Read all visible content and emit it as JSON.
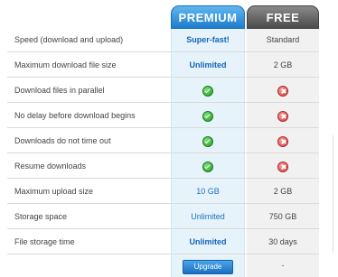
{
  "headers": {
    "premium": "PREMIUM",
    "free": "FREE"
  },
  "rows": [
    {
      "label": "Speed (download and upload)",
      "premium": "Super-fast!",
      "free": "Standard"
    },
    {
      "label": "Maximum download file size",
      "premium": "Unlimited",
      "free": "2 GB"
    },
    {
      "label": "Download files in parallel",
      "premium_icon": "check-icon",
      "free_icon": "cross-icon"
    },
    {
      "label": "No delay before download begins",
      "premium_icon": "check-icon",
      "free_icon": "cross-icon"
    },
    {
      "label": "Downloads do not time out",
      "premium_icon": "check-icon",
      "free_icon": "cross-icon"
    },
    {
      "label": "Resume downloads",
      "premium_icon": "check-icon",
      "free_icon": "cross-icon"
    },
    {
      "label": "Maximum upload size",
      "premium": "10 GB",
      "free": "2 GB"
    },
    {
      "label": "Storage space",
      "premium": "Unlimited",
      "free": "750 GB"
    },
    {
      "label": "File storage time",
      "premium": "Unlimited",
      "free": "30 days"
    }
  ],
  "footer": {
    "upgrade_label": "Upgrade",
    "free_value": "-"
  },
  "colors": {
    "premium_accent": "#1f7ccc",
    "free_accent": "#4b4b4b",
    "check": "#1f9a1f",
    "cross": "#d23b3b"
  }
}
